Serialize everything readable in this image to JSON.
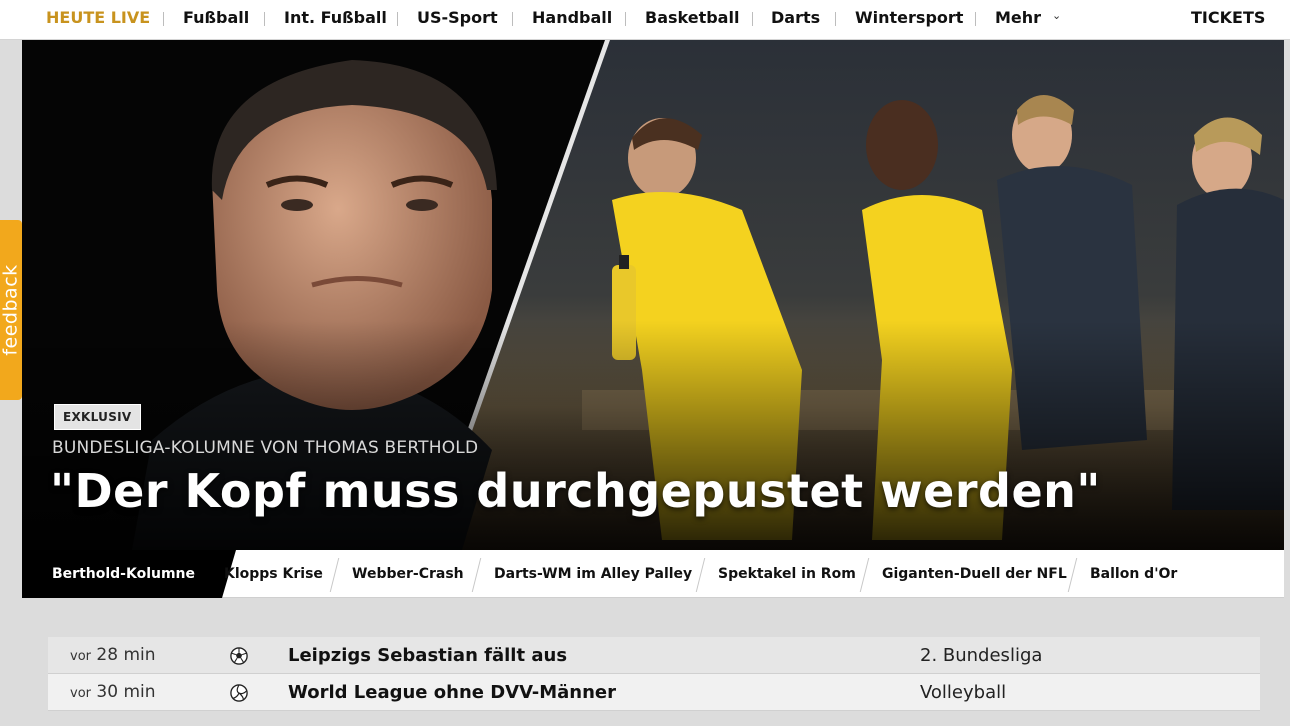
{
  "topnav": {
    "items": [
      {
        "label": "HEUTE LIVE"
      },
      {
        "label": "Fußball"
      },
      {
        "label": "Int. Fußball"
      },
      {
        "label": "US-Sport"
      },
      {
        "label": "Handball"
      },
      {
        "label": "Basketball"
      },
      {
        "label": "Darts"
      },
      {
        "label": "Wintersport"
      },
      {
        "label": "Mehr"
      }
    ],
    "tickets": "TICKETS"
  },
  "feedback": {
    "label": "feedback"
  },
  "hero": {
    "tag": "EXKLUSIV",
    "kicker": "BUNDESLIGA-KOLUMNE VON THOMAS BERTHOLD",
    "headline": "\"Der Kopf muss durchgepustet werden\""
  },
  "subtabs": [
    {
      "label": "Berthold-Kolumne",
      "active": true
    },
    {
      "label": "Klopps Krise"
    },
    {
      "label": "Webber-Crash"
    },
    {
      "label": "Darts-WM im Alley Palley"
    },
    {
      "label": "Spektakel in Rom"
    },
    {
      "label": "Giganten-Duell der NFL"
    },
    {
      "label": "Ballon d'Or"
    }
  ],
  "news": [
    {
      "time_prefix": "vor",
      "time": "28 min",
      "icon": "soccer-ball-icon",
      "title": "Leipzigs Sebastian fällt aus",
      "category": "2. Bundesliga"
    },
    {
      "time_prefix": "vor",
      "time": "30 min",
      "icon": "volleyball-icon",
      "title": "World League ohne DVV-Männer",
      "category": "Volleyball"
    }
  ],
  "colors": {
    "live_accent": "#c8931e",
    "feedback_bg": "#f2a81c",
    "bvb_yellow": "#f4d21f"
  }
}
